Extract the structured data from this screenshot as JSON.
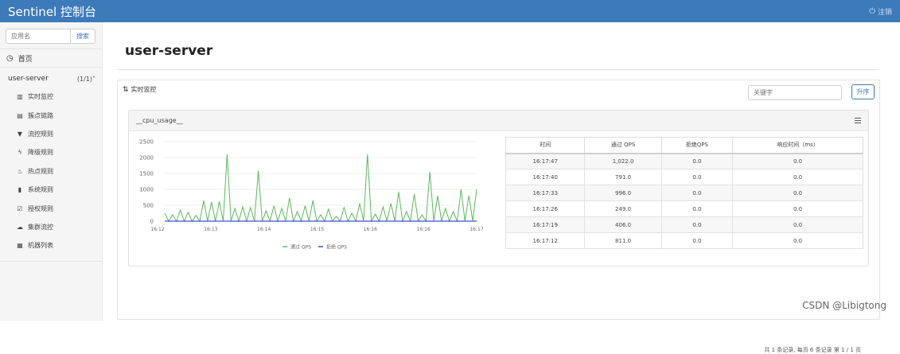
{
  "header": {
    "brand": "Sentinel 控制台",
    "logout_label": "注销"
  },
  "sidebar": {
    "search_placeholder": "应用名",
    "search_button": "搜索",
    "home_label": "首页",
    "app": {
      "name": "user-server",
      "count": "(1/1)"
    },
    "items": [
      {
        "label": "实时监控",
        "icon": "bar-chart-icon"
      },
      {
        "label": "簇点链路",
        "icon": "list-icon"
      },
      {
        "label": "流控规则",
        "icon": "filter-icon"
      },
      {
        "label": "降级规则",
        "icon": "flash-icon"
      },
      {
        "label": "热点规则",
        "icon": "fire-icon"
      },
      {
        "label": "系统规则",
        "icon": "lock-icon"
      },
      {
        "label": "授权规则",
        "icon": "check-circle-icon"
      },
      {
        "label": "集群流控",
        "icon": "cloud-icon"
      },
      {
        "label": "机器列表",
        "icon": "grid-icon"
      }
    ]
  },
  "main": {
    "page_title": "user-server",
    "panel_title": "实时监控",
    "keyword_placeholder": "关键字",
    "sort_button": "升序",
    "resource_name": "__cpu_usage__",
    "table": {
      "headers": [
        "时间",
        "通过 QPS",
        "拒绝QPS",
        "响应时间（ms）"
      ],
      "rows": [
        [
          "16:17:47",
          "1,022.0",
          "0.0",
          "0.0"
        ],
        [
          "16:17:40",
          "791.0",
          "0.0",
          "0.0"
        ],
        [
          "16:17:33",
          "996.0",
          "0.0",
          "0.0"
        ],
        [
          "16:17:26",
          "249.0",
          "0.0",
          "0.0"
        ],
        [
          "16:17:19",
          "406.0",
          "0.0",
          "0.0"
        ],
        [
          "16:17:12",
          "811.0",
          "0.0",
          "0.0"
        ]
      ]
    },
    "pagination": "共 1 条记录, 每页 6 条记录 第 1 / 1 页"
  },
  "watermark": "CSDN @Libigtong",
  "colors": {
    "header": "#3c7ab9",
    "pass_qps": "#5cb85c",
    "block_qps": "#3b4fcf"
  },
  "chart_data": {
    "type": "line",
    "x": [
      "16:12",
      "16:13",
      "16:14",
      "16:15",
      "16:16",
      "16:16",
      "16:17"
    ],
    "ylim": [
      0,
      2500
    ],
    "yticks": [
      "0",
      "500",
      "1000",
      "1500",
      "2000",
      "2500"
    ],
    "legend_position": "bottom",
    "series": [
      {
        "name": "通过 QPS",
        "color": "#5cb85c",
        "values": [
          250,
          0,
          200,
          0,
          350,
          0,
          280,
          0,
          180,
          0,
          650,
          0,
          600,
          0,
          620,
          0,
          2100,
          0,
          400,
          0,
          450,
          0,
          430,
          0,
          1580,
          0,
          320,
          0,
          480,
          0,
          400,
          0,
          730,
          0,
          300,
          0,
          480,
          0,
          650,
          0,
          200,
          0,
          380,
          0,
          150,
          0,
          430,
          0,
          250,
          0,
          560,
          0,
          2100,
          0,
          220,
          0,
          450,
          0,
          560,
          0,
          920,
          0,
          300,
          0,
          850,
          0,
          200,
          0,
          1550,
          0,
          800,
          0,
          400,
          0,
          300,
          0,
          1000,
          0,
          800,
          0,
          1000
        ]
      },
      {
        "name": "拒绝 QPS",
        "color": "#3b4fcf",
        "values": [
          0,
          0
        ]
      }
    ]
  }
}
